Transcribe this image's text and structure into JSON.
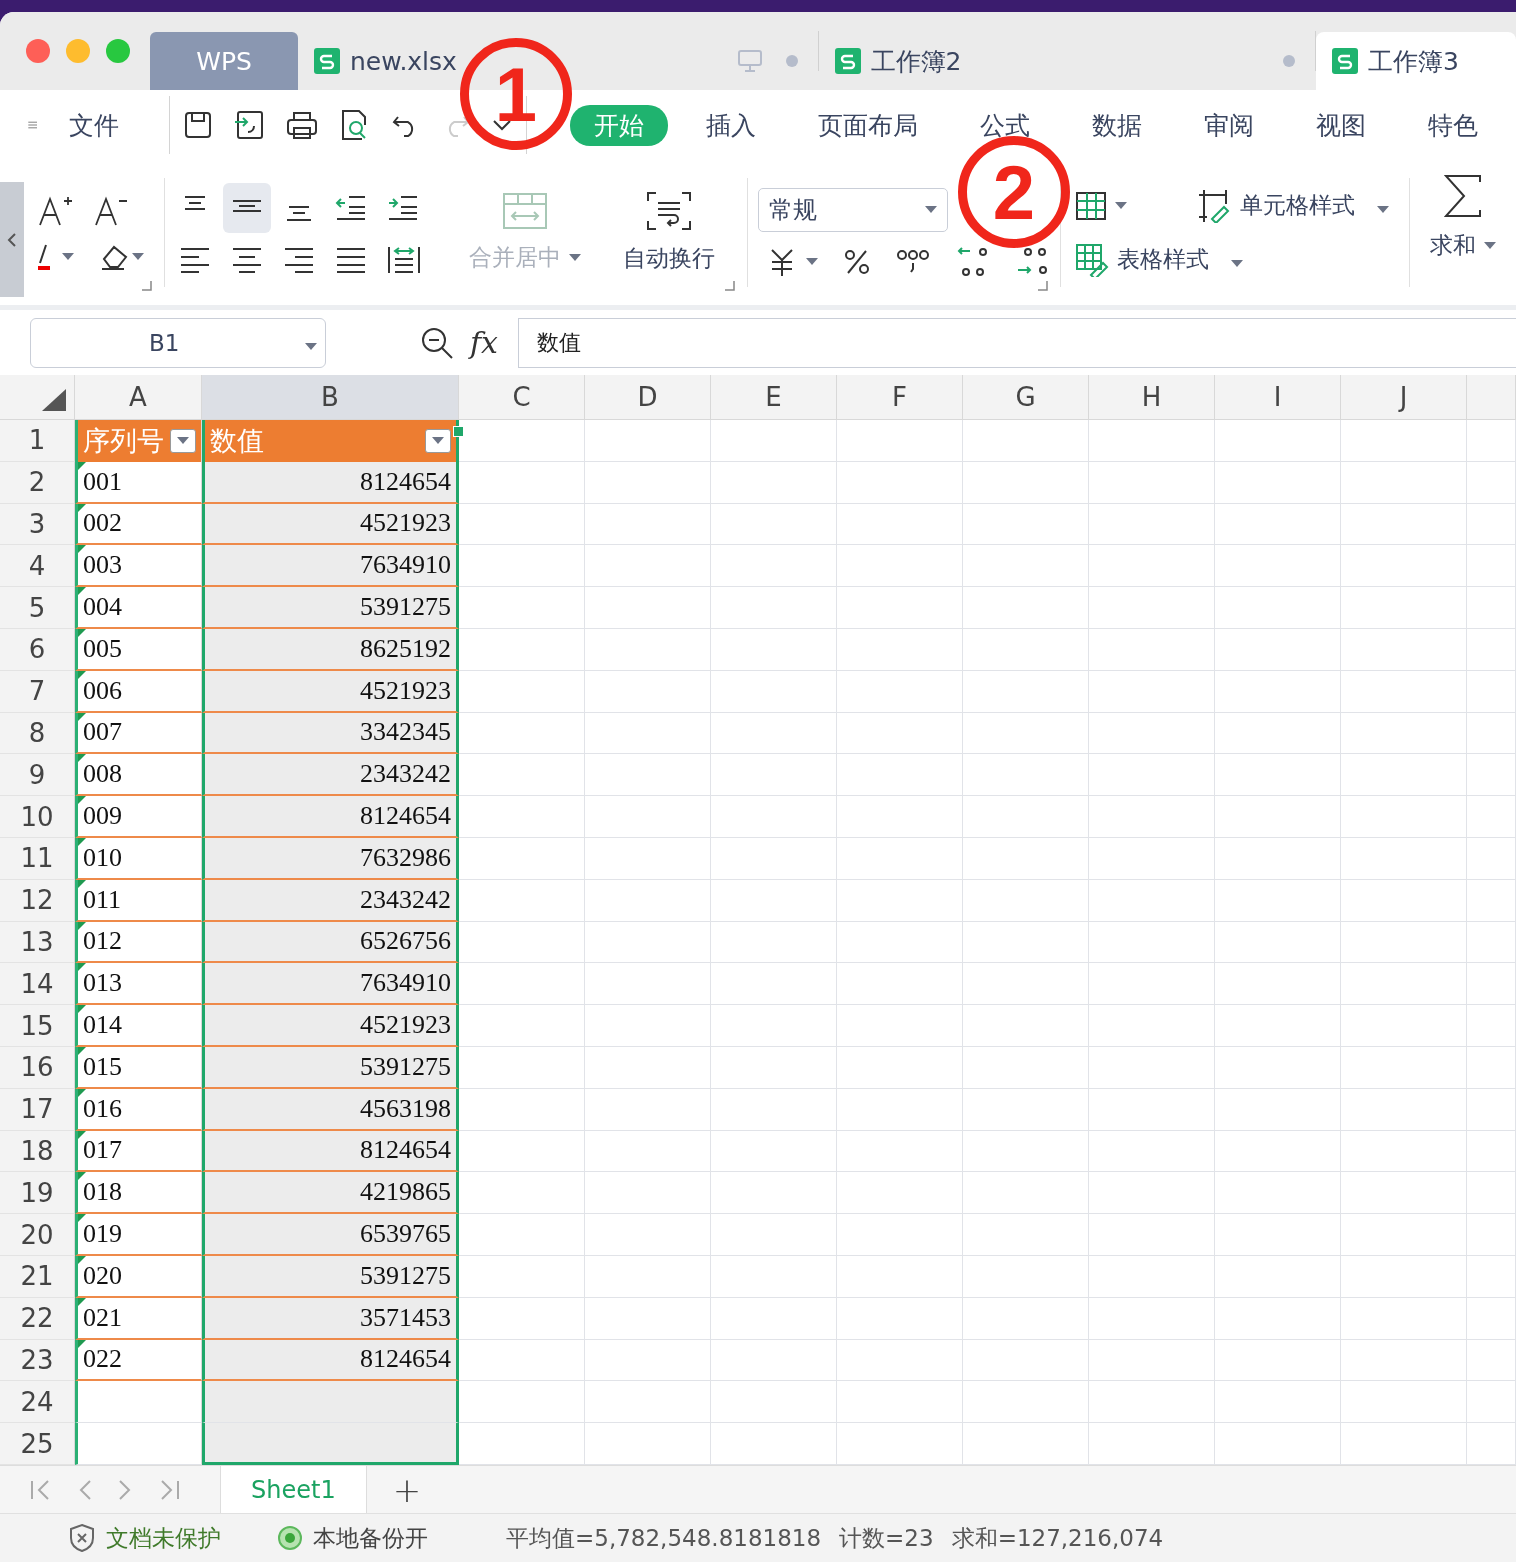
{
  "tabs": [
    {
      "kind": "home",
      "label": "WPS",
      "selected": false
    },
    {
      "kind": "document",
      "label": "new.xlsx",
      "selected": false,
      "unsaved": true,
      "monitor": true
    },
    {
      "kind": "document",
      "label": "工作簿2",
      "selected": false,
      "unsaved": true,
      "monitor": false
    },
    {
      "kind": "document",
      "label": "工作簿3",
      "selected": true,
      "unsaved": false,
      "monitor": false
    }
  ],
  "menu": {
    "file": "文件",
    "ribbon_tabs": [
      {
        "label": "开始",
        "selected": true
      },
      {
        "label": "插入",
        "selected": false
      },
      {
        "label": "页面布局",
        "selected": false
      },
      {
        "label": "公式",
        "selected": false
      },
      {
        "label": "数据",
        "selected": false
      },
      {
        "label": "审阅",
        "selected": false
      },
      {
        "label": "视图",
        "selected": false
      },
      {
        "label": "特色",
        "selected": false
      }
    ]
  },
  "ribbon": {
    "merge": {
      "label": "合并居中",
      "disabled": true
    },
    "wrap": {
      "label": "自动换行",
      "disabled": false
    },
    "number_format": "常规",
    "cell_style": "单元格样式",
    "table_style": "表格样式",
    "sum": "求和"
  },
  "formula_bar": {
    "name_box": "B1",
    "function_label": "fx",
    "value": "数值"
  },
  "columns": [
    "A",
    "B",
    "C",
    "D",
    "E",
    "F",
    "G",
    "H",
    "I",
    "J"
  ],
  "table": {
    "headers": [
      "序列号",
      "数值"
    ],
    "rows": [
      [
        "001",
        "8124654"
      ],
      [
        "002",
        "4521923"
      ],
      [
        "003",
        "7634910"
      ],
      [
        "004",
        "5391275"
      ],
      [
        "005",
        "8625192"
      ],
      [
        "006",
        "4521923"
      ],
      [
        "007",
        "3342345"
      ],
      [
        "008",
        "2343242"
      ],
      [
        "009",
        "8124654"
      ],
      [
        "010",
        "7632986"
      ],
      [
        "011",
        "2343242"
      ],
      [
        "012",
        "6526756"
      ],
      [
        "013",
        "7634910"
      ],
      [
        "014",
        "4521923"
      ],
      [
        "015",
        "5391275"
      ],
      [
        "016",
        "4563198"
      ],
      [
        "017",
        "8124654"
      ],
      [
        "018",
        "4219865"
      ],
      [
        "019",
        "6539765"
      ],
      [
        "020",
        "5391275"
      ],
      [
        "021",
        "3571453"
      ],
      [
        "022",
        "8124654"
      ]
    ]
  },
  "row_numbers": [
    "1",
    "2",
    "3",
    "4",
    "5",
    "6",
    "7",
    "8",
    "9",
    "10",
    "11",
    "12",
    "13",
    "14",
    "15",
    "16",
    "17",
    "18",
    "19",
    "20",
    "21",
    "22",
    "23",
    "24",
    "25"
  ],
  "sheets": [
    {
      "label": "Sheet1",
      "selected": true
    }
  ],
  "add_sheet": "+",
  "status_bar": {
    "protection": "文档未保护",
    "backup": "本地备份开",
    "average": "平均值=5,782,548.8181818",
    "count": "计数=23",
    "sum": "求和=127,216,074"
  },
  "annotations": [
    "1",
    "2"
  ]
}
